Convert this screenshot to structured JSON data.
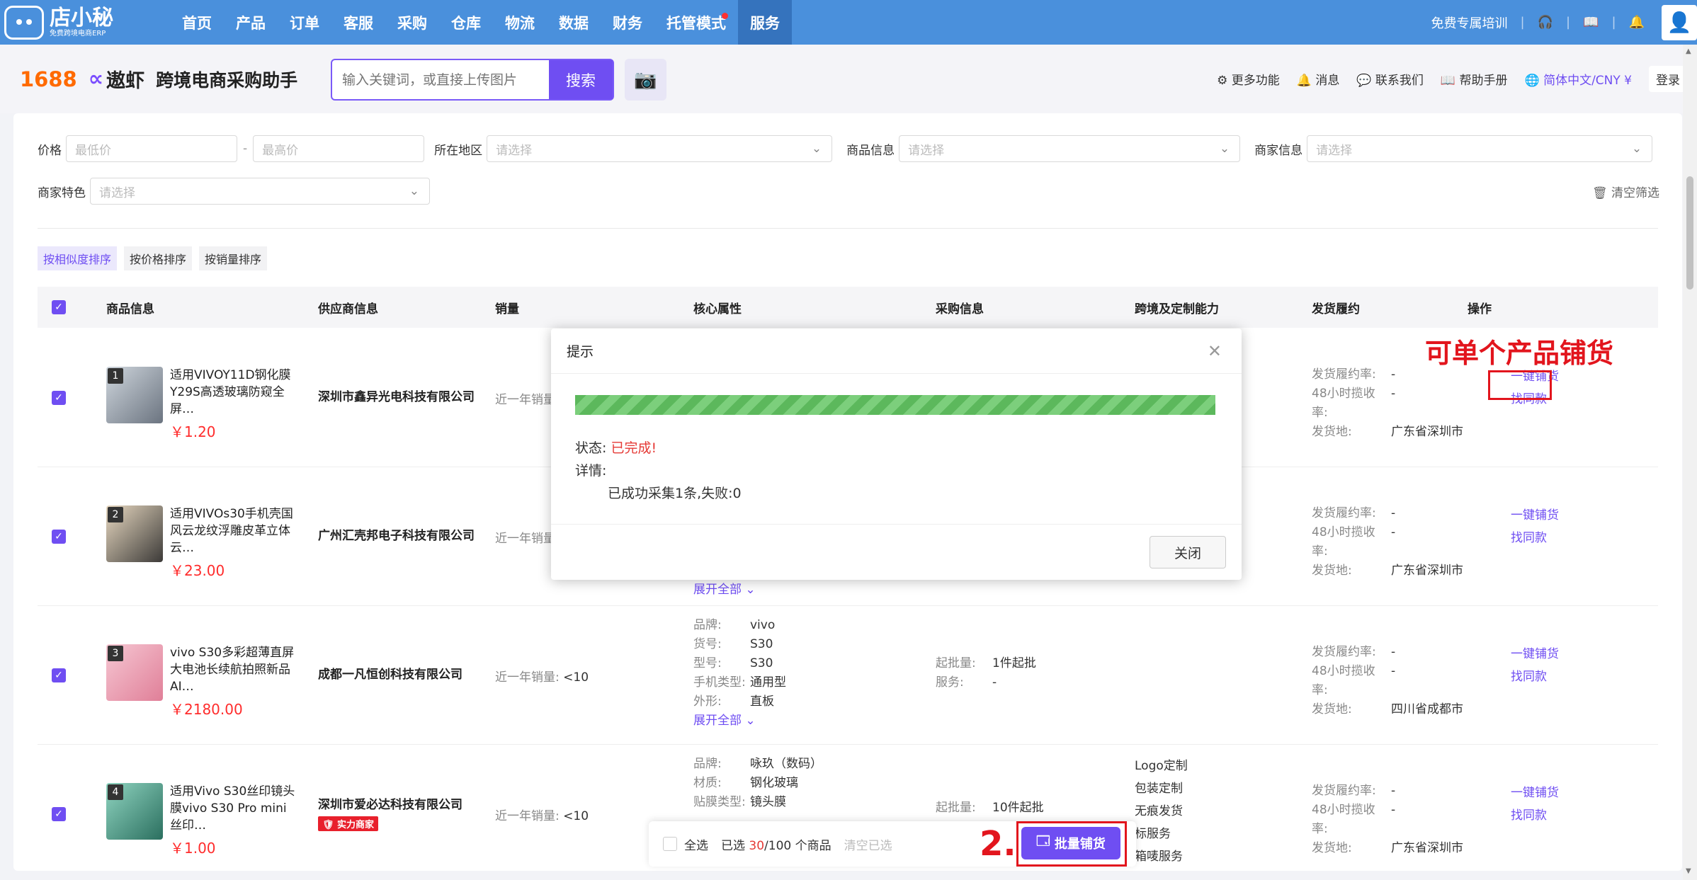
{
  "topnav": {
    "logo_title": "店小秘",
    "logo_sub": "免费跨境电商ERP",
    "items": [
      {
        "label": "首页"
      },
      {
        "label": "产品"
      },
      {
        "label": "订单"
      },
      {
        "label": "客服"
      },
      {
        "label": "采购"
      },
      {
        "label": "仓库"
      },
      {
        "label": "物流"
      },
      {
        "label": "数据"
      },
      {
        "label": "财务"
      },
      {
        "label": "托管模式"
      },
      {
        "label": "服务"
      }
    ],
    "training": "免费专属培训"
  },
  "subbar": {
    "brand_1688": "1688",
    "brand_ao": "遨虾",
    "title": "跨境电商采购助手",
    "search_placeholder": "输入关键词，或直接上传图片",
    "search_button": "搜索",
    "links": {
      "more": "更多功能",
      "message": "消息",
      "contact": "联系我们",
      "manual": "帮助手册",
      "lang": "简体中文/CNY ¥",
      "login": "登录"
    }
  },
  "filters": {
    "price_label": "价格",
    "price_min": "最低价",
    "price_max": "最高价",
    "price_sep": "-",
    "region_label": "所在地区",
    "region_ph": "请选择",
    "product_label": "商品信息",
    "product_ph": "请选择",
    "merchant_label": "商家信息",
    "merchant_ph": "请选择",
    "feature_label": "商家特色",
    "feature_ph": "请选择",
    "clear": "清空筛选"
  },
  "sorts": [
    "按相似度排序",
    "按价格排序",
    "按销量排序"
  ],
  "table": {
    "headers": [
      "商品信息",
      "供应商信息",
      "销量",
      "核心属性",
      "采购信息",
      "跨境及定制能力",
      "发货履约",
      "操作"
    ],
    "rows": [
      {
        "num": "1",
        "name": "适用VIVOY11D钢化膜Y29S高透玻璃防窥全屏…",
        "price": "￥1.20",
        "supplier": "深圳市鑫异光电科技有限公司",
        "sales_label": "近一年销量:",
        "sales": "",
        "ship_rate_k": "发货履约率:",
        "ship_rate": "-",
        "collect_k": "48小时揽收率:",
        "collect": "-",
        "origin_k": "发货地:",
        "origin": "广东省深圳市",
        "op1": "一键铺货",
        "op2": "找同款"
      },
      {
        "num": "2",
        "name": "适用VIVOs30手机壳国风云龙纹浮雕皮革立体云…",
        "price": "￥23.00",
        "supplier": "广州汇壳邦电子科技有限公司",
        "sales_label": "近一年销量:",
        "sales": "",
        "expand": "展开全部",
        "ship_rate_k": "发货履约率:",
        "ship_rate": "-",
        "collect_k": "48小时揽收率:",
        "collect": "-",
        "origin_k": "发货地:",
        "origin": "广东省深圳市",
        "op1": "一键铺货",
        "op2": "找同款"
      },
      {
        "num": "3",
        "name": "vivo S30多彩超薄直屏大电池长续航拍照新品AI…",
        "price": "￥2180.00",
        "supplier": "成都一凡恒创科技有限公司",
        "sales_label": "近一年销量:",
        "sales": "<10",
        "attrs": [
          {
            "k": "品牌:",
            "v": "vivo"
          },
          {
            "k": "货号:",
            "v": "S30"
          },
          {
            "k": "型号:",
            "v": "S30"
          },
          {
            "k": "手机类型:",
            "v": "通用型"
          },
          {
            "k": "外形:",
            "v": "直板"
          }
        ],
        "expand": "展开全部",
        "moq_k": "起批量:",
        "moq": "1件起批",
        "service_k": "服务:",
        "service": "-",
        "ship_rate_k": "发货履约率:",
        "ship_rate": "-",
        "collect_k": "48小时揽收率:",
        "collect": "-",
        "origin_k": "发货地:",
        "origin": "四川省成都市",
        "op1": "一键铺货",
        "op2": "找同款"
      },
      {
        "num": "4",
        "name": "适用Vivo S30丝印镜头膜vivo S30 Pro mini丝印…",
        "price": "￥1.00",
        "supplier": "深圳市爱必达科技有限公司",
        "badge": "实力商家",
        "sales_label": "近一年销量:",
        "sales": "<10",
        "attrs": [
          {
            "k": "品牌:",
            "v": "咏玖（数码）"
          },
          {
            "k": "材质:",
            "v": "钢化玻璃"
          },
          {
            "k": "贴膜类型:",
            "v": "镜头膜"
          }
        ],
        "moq_k": "起批量:",
        "moq": "10件起批",
        "custom": [
          "Logo定制",
          "包装定制",
          "无痕发货",
          "标服务",
          "箱唛服务"
        ],
        "ship_rate_k": "发货履约率:",
        "ship_rate": "-",
        "collect_k": "48小时揽收率:",
        "collect": "-",
        "origin_k": "发货地:",
        "origin": "广东省深圳市",
        "op1": "一键铺货",
        "op2": "找同款"
      }
    ]
  },
  "modal": {
    "title": "提示",
    "status_label": "状态:",
    "status_value": "已完成!",
    "detail_label": "详情:",
    "detail_msg": "已成功采集1条,失败:0",
    "close_button": "关闭",
    "progress": 1.0
  },
  "bottombar": {
    "select_all": "全选",
    "selected_prefix": "已选",
    "selected_num": "30",
    "selected_suffix": "/100 个商品",
    "clear_selected": "清空已选",
    "batch_button": "批量铺货"
  },
  "annotations": {
    "single": "可单个产品铺货",
    "step": "2."
  },
  "colors": {
    "nav_bg": "#4a90dc",
    "accent": "#6f4ef2",
    "annotation": "#e2151d",
    "price": "#ff2c2c"
  }
}
